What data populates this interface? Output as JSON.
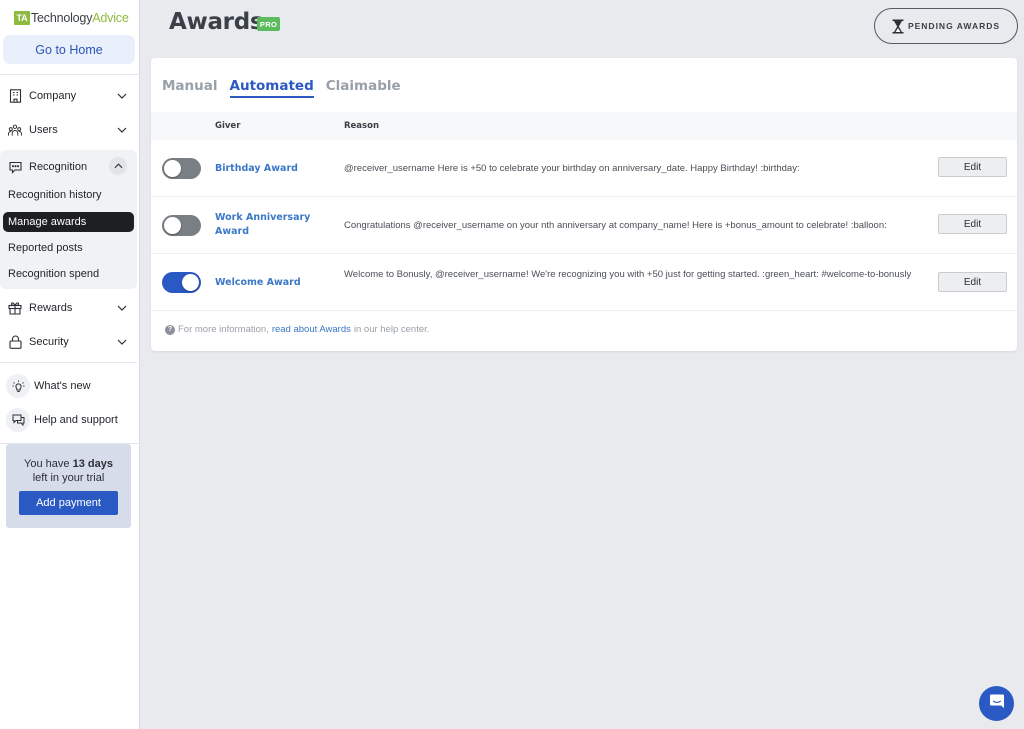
{
  "brand": {
    "logo_mark": "TA",
    "logo_part1": "Technology",
    "logo_part2": "Advice",
    "accent": "#2b59c3",
    "logo_green": "#8dba3f"
  },
  "sidebar": {
    "home_label": "Go to Home",
    "items": [
      {
        "label": "Company",
        "icon": "building-icon",
        "expanded": false
      },
      {
        "label": "Users",
        "icon": "users-icon",
        "expanded": false
      },
      {
        "label": "Recognition",
        "icon": "chat-bubble-icon",
        "expanded": true
      },
      {
        "label": "Rewards",
        "icon": "gift-icon",
        "expanded": false
      },
      {
        "label": "Security",
        "icon": "lock-icon",
        "expanded": false
      }
    ],
    "recognition_sub": [
      {
        "label": "Recognition history",
        "active": false
      },
      {
        "label": "Manage awards",
        "active": true
      },
      {
        "label": "Reported posts",
        "active": false
      },
      {
        "label": "Recognition spend",
        "active": false
      }
    ],
    "utility": [
      {
        "label": "What's new",
        "icon": "lightbulb-icon"
      },
      {
        "label": "Help and support",
        "icon": "support-chat-icon"
      }
    ],
    "trial": {
      "prefix": "You have ",
      "days": "13 days",
      "suffix": "left in your trial",
      "button": "Add payment"
    }
  },
  "header": {
    "title": "Awards",
    "badge": "PRO",
    "pending_button": "PENDING AWARDS"
  },
  "tabs": [
    {
      "label": "Manual",
      "active": false
    },
    {
      "label": "Automated",
      "active": true
    },
    {
      "label": "Claimable",
      "active": false
    }
  ],
  "table": {
    "columns": [
      "Giver",
      "Reason"
    ],
    "rows": [
      {
        "enabled": false,
        "name": "Birthday Award",
        "reason": "@receiver_username Here is +50 to celebrate your birthday on anniversary_date. Happy Birthday! :birthday:",
        "action": "Edit"
      },
      {
        "enabled": false,
        "name": "Work Anniversary Award",
        "reason": "Congratulations @receiver_username on your nth anniversary at company_name! Here is +bonus_amount to celebrate! :balloon:",
        "action": "Edit"
      },
      {
        "enabled": true,
        "name": "Welcome Award",
        "reason": "Welcome to Bonusly, @receiver_username! We're recognizing you with +50 just for getting started. :green_heart: #welcome-to-bonusly",
        "action": "Edit"
      }
    ]
  },
  "footer": {
    "prefix": "For more information,",
    "link": "read about Awards",
    "suffix": "in our help center."
  }
}
